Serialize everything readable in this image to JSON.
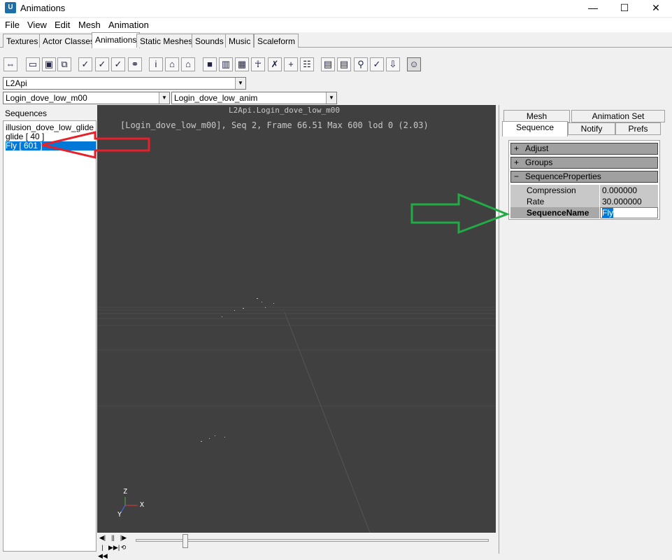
{
  "window": {
    "title": "Animations",
    "icon_text": "U",
    "minimize_glyph": "—",
    "maximize_glyph": "☐",
    "close_glyph": "✕"
  },
  "menubar": [
    "File",
    "View",
    "Edit",
    "Mesh",
    "Animation"
  ],
  "tabs": [
    {
      "label": "Textures",
      "active": false
    },
    {
      "label": "Actor Classes",
      "active": false
    },
    {
      "label": "Animations",
      "active": true
    },
    {
      "label": "Static Meshes",
      "active": false
    },
    {
      "label": "Sounds",
      "active": false
    },
    {
      "label": "Music",
      "active": false
    },
    {
      "label": "Scaleform",
      "active": false
    }
  ],
  "toolbar_icons": [
    "import-icon",
    "open-folder-icon",
    "save-icon",
    "copy-icon",
    "prop-a-icon",
    "prop-b-icon",
    "prop-c-icon",
    "link-icon",
    "info-icon",
    "house-a-icon",
    "house-b-icon",
    "cube-icon",
    "frames-icon",
    "grid-icon",
    "figure-icon",
    "bone-icon",
    "plus-marker-icon",
    "skeleton-icon",
    "stack-a-icon",
    "stack-b-icon",
    "bones-icon",
    "notify-icon",
    "download-icon",
    "viewer-icon"
  ],
  "package_combo": {
    "value": "L2Api"
  },
  "mesh_combo": {
    "value": "Login_dove_low_m00"
  },
  "anim_combo": {
    "value": "Login_dove_low_anim"
  },
  "sequences": {
    "label": "Sequences",
    "items": [
      {
        "label": "illusion_dove_low_glide [ 40 ]",
        "selected": false
      },
      {
        "label": "glide [ 40 ]",
        "selected": false
      },
      {
        "label": "Fly [ 601 ]",
        "selected": true
      }
    ]
  },
  "viewport": {
    "title": "L2Api.Login_dove_low_m00",
    "status": "[Login_dove_low_m00], Seq 2,  Frame 66.51 Max 600  lod 0 (2.03)",
    "axis_z": "Z",
    "axis_x": "X",
    "axis_y": "Y",
    "background": "#404040"
  },
  "playback": {
    "top_glyphs": [
      "◀|",
      "||",
      "|▶"
    ],
    "bottom_glyphs": [
      "|◀◀",
      "▶▶|",
      "⟲"
    ],
    "slider_value": 0.14
  },
  "right_tabs": {
    "row1": [
      {
        "label": "Mesh"
      },
      {
        "label": "Animation Set"
      }
    ],
    "row2": [
      {
        "label": "Sequence",
        "active": true
      },
      {
        "label": "Notify"
      },
      {
        "label": "Prefs"
      }
    ]
  },
  "properties": {
    "categories": [
      {
        "sign": "+",
        "label": "Adjust"
      },
      {
        "sign": "+",
        "label": "Groups"
      },
      {
        "sign": "−",
        "label": "SequenceProperties"
      }
    ],
    "rows": [
      {
        "name": "Compression",
        "value": "0.000000"
      },
      {
        "name": "Rate",
        "value": "30.000000"
      },
      {
        "name": "SequenceName",
        "value": "Fly",
        "editing": true
      }
    ]
  },
  "annotations": {
    "red_arrow_color": "#e8202a",
    "green_arrow_color": "#22aa44"
  }
}
